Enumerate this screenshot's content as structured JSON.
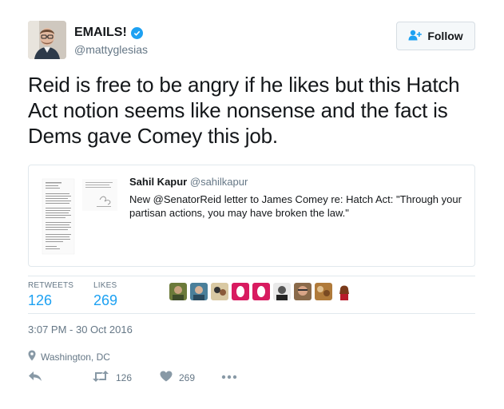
{
  "author": {
    "display_name": "EMAILS!",
    "handle": "@mattyglesias",
    "verified_icon": "verified-badge-icon"
  },
  "follow_button": {
    "label": "Follow",
    "icon": "add-user-icon"
  },
  "tweet": {
    "text": "Reid is free to be angry if he likes but this Hatch Act notion seems like nonsense and the fact is Dems gave Comey this job."
  },
  "quoted_tweet": {
    "name": "Sahil Kapur",
    "handle": "@sahilkapur",
    "text": "New @SenatorReid letter to James Comey re: Hatch Act: \"Through your partisan actions, you may have broken the law.\""
  },
  "stats": {
    "retweets_label": "RETWEETS",
    "retweets_value": "126",
    "likes_label": "LIKES",
    "likes_value": "269"
  },
  "timestamp": "3:07 PM - 30 Oct 2016",
  "location": "Washington, DC",
  "actions": {
    "retweet_count": "126",
    "like_count": "269"
  },
  "colors": {
    "accent": "#1da1f2",
    "muted": "#657786",
    "border": "#e1e8ed"
  }
}
